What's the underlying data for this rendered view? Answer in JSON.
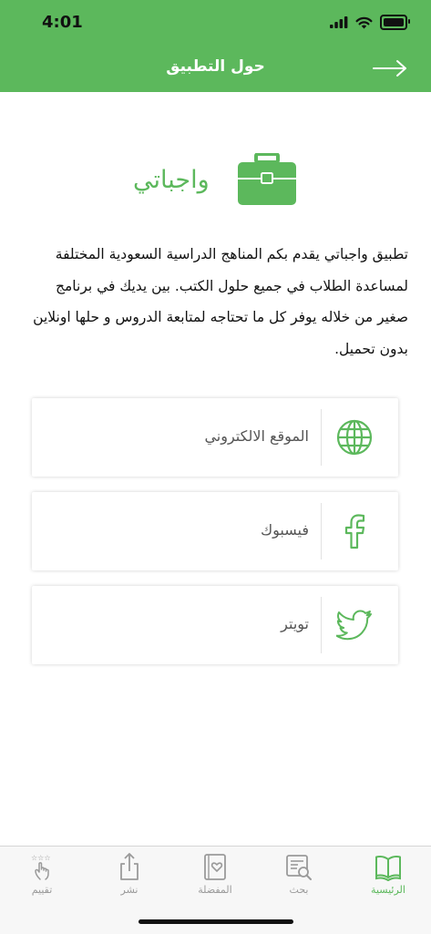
{
  "status": {
    "time": "4:01"
  },
  "nav": {
    "title": "حول التطبيق"
  },
  "app": {
    "name": "واجباتي"
  },
  "description": "تطبيق واجباتي يقدم بكم المناهج  الدراسية السعودية المختلفة لمساعدة الطلاب في جميع حلول الكتب. بين يديك في برنامج صغير من خلاله يوفر كل ما تحتاجه لمتابعة الدروس و حلها اونلاين بدون تحميل.",
  "links": [
    {
      "label": "الموقع الالكتروني",
      "icon": "globe-icon"
    },
    {
      "label": "فيسبوك",
      "icon": "facebook-icon"
    },
    {
      "label": "تويتر",
      "icon": "twitter-icon"
    }
  ],
  "tabs": [
    {
      "label": "الرئيسية",
      "icon": "book-icon",
      "active": true
    },
    {
      "label": "بحث",
      "icon": "search-icon"
    },
    {
      "label": "المفضلة",
      "icon": "favorite-icon"
    },
    {
      "label": "نشر",
      "icon": "share-icon"
    },
    {
      "label": "تقييم",
      "icon": "rate-icon"
    }
  ],
  "colors": {
    "accent": "#5cb85c",
    "inactive": "#9a9a9a"
  }
}
